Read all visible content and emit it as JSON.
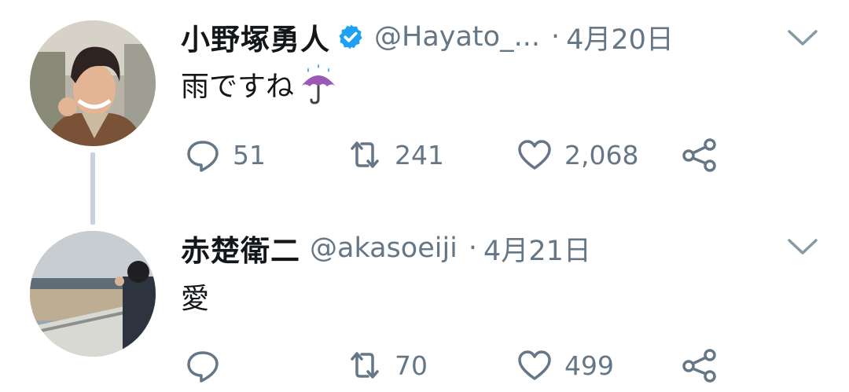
{
  "tweets": [
    {
      "name": "小野塚勇人",
      "verified": true,
      "handle": "@Hayato_...",
      "separator": "·",
      "date": "4月20日",
      "text": "雨ですね",
      "emoji": "umbrella-with-rain-icon",
      "replies": "51",
      "retweets": "241",
      "likes": "2,068"
    },
    {
      "name": "赤楚衛二",
      "verified": false,
      "handle": "@akasoeiji",
      "separator": "·",
      "date": "4月21日",
      "text": "愛",
      "replies": "",
      "retweets": "70",
      "likes": "499"
    }
  ],
  "colors": {
    "text": "#14171a",
    "secondary": "#657786",
    "verified": "#1da1f2",
    "thread_line": "#c8d1da"
  }
}
